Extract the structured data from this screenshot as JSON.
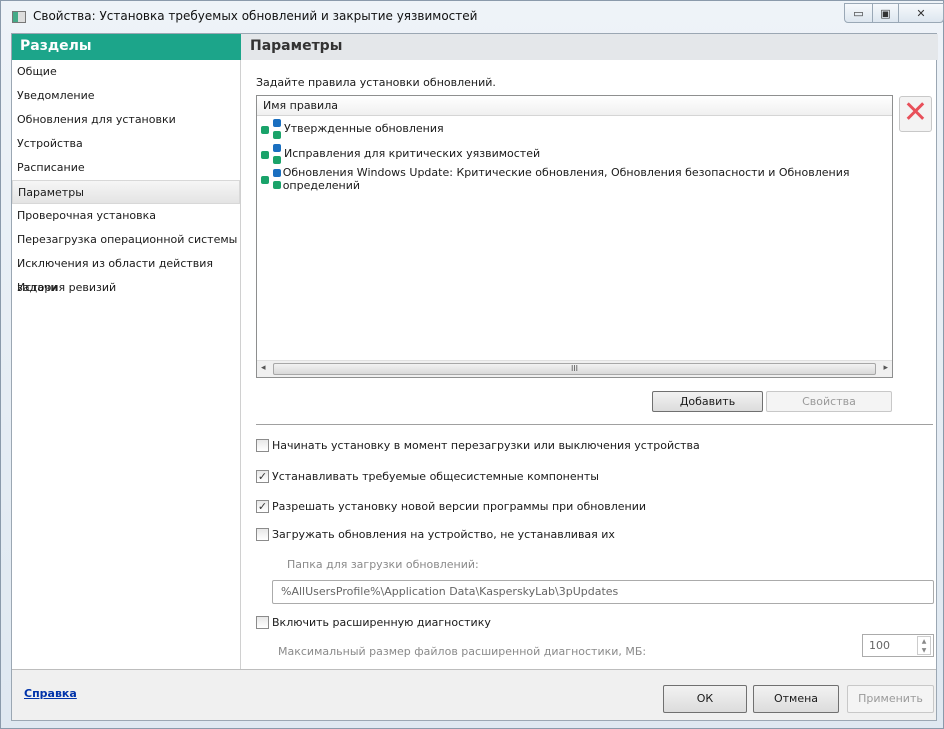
{
  "window": {
    "title": "Свойства: Установка требуемых обновлений и закрытие уязвимостей",
    "min": "▭",
    "max": "▣",
    "close": "✕"
  },
  "sidebar": {
    "header": "Разделы",
    "items": [
      "Общие",
      "Уведомление",
      "Обновления для установки",
      "Устройства",
      "Расписание",
      "Параметры",
      "Проверочная установка",
      "Перезагрузка операционной системы",
      "Исключения из области действия задачи",
      "История ревизий"
    ],
    "selected": "Параметры"
  },
  "main": {
    "header": "Параметры",
    "intro": "Задайте правила установки обновлений.",
    "list": {
      "column": "Имя правила",
      "rows": [
        "Утвержденные обновления",
        "Исправления для критических уязвимостей",
        "Обновления Windows Update: Критические обновления, Обновления безопасности и Обновления определений"
      ],
      "scroll_grip": "III",
      "scroll_left": "◂",
      "scroll_right": "▸"
    },
    "delete_icon": "✕",
    "add_button": "Добавить",
    "properties_button": "Свойства",
    "options": [
      {
        "label": "Начинать установку в момент перезагрузки или выключения устройства",
        "checked": false
      },
      {
        "label": "Устанавливать требуемые общесистемные компоненты",
        "checked": true
      },
      {
        "label": "Разрешать установку новой версии программы при обновлении",
        "checked": true
      },
      {
        "label": "Загружать обновления на устройство, не устанавливая их",
        "checked": false
      }
    ],
    "folder_label": "Папка для загрузки обновлений:",
    "folder_value": "%AllUsersProfile%\\Application Data\\KasperskyLab\\3pUpdates",
    "diag": {
      "label": "Включить расширенную диагностику",
      "checked": false
    },
    "max_size_label": "Максимальный размер файлов расширенной диагностики, МБ:",
    "max_size_value": "100",
    "spin_up": "▲",
    "spin_down": "▼"
  },
  "footer": {
    "help": "Справка",
    "ok": "ОК",
    "cancel": "Отмена",
    "apply": "Применить"
  },
  "colors": {
    "accent": "#1ca58a",
    "delete": "#e8505a"
  }
}
